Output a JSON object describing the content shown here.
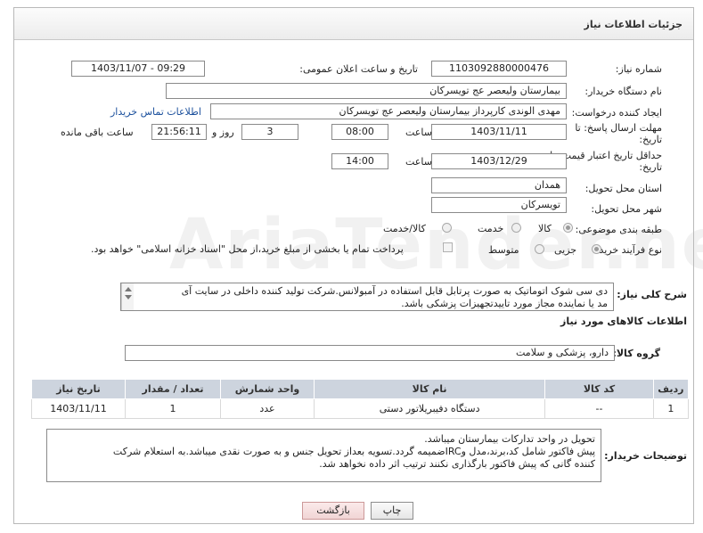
{
  "panel": {
    "title": "جزئیات اطلاعات نیاز"
  },
  "watermark": "AriaTender.neT",
  "fields": {
    "need_number": {
      "label": "شماره نیاز:",
      "value": "1103092880000476"
    },
    "announce_datetime": {
      "label": "تاریخ و ساعت اعلان عمومی:",
      "value": "1403/11/07 - 09:29"
    },
    "buyer_org": {
      "label": "نام دستگاه خریدار:",
      "value": "بیمارستان ولیعصر  عج  تویسرکان"
    },
    "requester": {
      "label": "ایجاد کننده درخواست:",
      "value": "مهدی الوندی کارپرداز بیمارستان ولیعصر  عج  تویسرکان",
      "contact_link": "اطلاعات تماس خریدار"
    },
    "reply_deadline": {
      "label": "مهلت ارسال پاسخ: تا",
      "label2": "تاریخ:",
      "date": "1403/11/11",
      "time_label": "ساعت",
      "time": "08:00",
      "days": "3",
      "days_label": "روز و",
      "remaining": "21:56:11",
      "remaining_label": "ساعت باقی مانده"
    },
    "price_validity": {
      "label": "حداقل تاریخ اعتبار قیمت: تا",
      "label2": "تاریخ:",
      "date": "1403/12/29",
      "time_label": "ساعت",
      "time": "14:00"
    },
    "province": {
      "label": "استان محل تحویل:",
      "value": "همدان"
    },
    "city": {
      "label": "شهر محل تحویل:",
      "value": "تویسرکان"
    },
    "category": {
      "label": "طبقه بندی موضوعی:",
      "options": [
        "کالا",
        "خدمت",
        "کالا/خدمت"
      ]
    },
    "purchase_process": {
      "label": "نوع فرآیند خرید :",
      "options": [
        "جزیی",
        "متوسط"
      ],
      "treasury_text": "پرداخت تمام یا بخشی از مبلغ خرید،از محل \"اسناد خزانه اسلامی\" خواهد بود."
    },
    "general_description": {
      "label": "شرح کلی نیاز:",
      "line1": "دی سی شوک اتوماتیک به صورت پرتابل قابل استفاده در آمبولانس.شرکت تولید کننده داخلی در سایت آی",
      "line2": "مد یا نماینده مجاز مورد تاییدتجهیزات پزشکی باشد."
    }
  },
  "goods": {
    "section_title": "اطلاعات کالاهای مورد نیاز",
    "group_label": "گروه کالا:",
    "group_value": "دارو، پزشکی و سلامت",
    "columns": [
      "ردیف",
      "کد کالا",
      "نام کالا",
      "واحد شمارش",
      "تعداد / مقدار",
      "تاریخ نیاز"
    ],
    "rows": [
      [
        "1",
        "--",
        "دستگاه دفیبریلاتور دستی",
        "عدد",
        "1",
        "1403/11/11"
      ]
    ]
  },
  "buyer_notes": {
    "label": "توضیحات خریدار:",
    "line1": "تحویل در واحد تدارکات بیمارستان میباشد.",
    "line2": "پیش فاکتور شامل کد،برند،مدل وIRCضمیمه گردد.تسویه بعداز تحویل جنس و به صورت نقدی میباشد.به استعلام شرکت",
    "line3": "کننده گانی که پیش فاکتور بارگذاری نکنند ترتیب اثر داده نخواهد شد."
  },
  "buttons": {
    "print": "چاپ",
    "back": "بازگشت"
  }
}
